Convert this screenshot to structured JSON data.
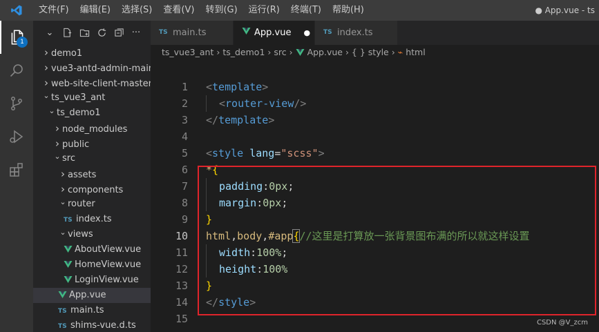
{
  "menu": [
    "文件(F)",
    "编辑(E)",
    "选择(S)",
    "查看(V)",
    "转到(G)",
    "运行(R)",
    "终端(T)",
    "帮助(H)"
  ],
  "window_title": "● App.vue - ts",
  "activity": {
    "badge": "1"
  },
  "explorer": {
    "items": [
      {
        "label": "demo1",
        "kind": "folder",
        "open": false,
        "depth": 0
      },
      {
        "label": "vue3-antd-admin-main",
        "kind": "folder",
        "open": false,
        "depth": 0
      },
      {
        "label": "web-site-client-master",
        "kind": "folder",
        "open": false,
        "depth": 0
      },
      {
        "label": "ts_vue3_ant",
        "kind": "folder",
        "open": true,
        "depth": 0
      },
      {
        "label": "ts_demo1",
        "kind": "folder",
        "open": true,
        "depth": 1
      },
      {
        "label": "node_modules",
        "kind": "folder",
        "open": false,
        "depth": 2
      },
      {
        "label": "public",
        "kind": "folder",
        "open": false,
        "depth": 2
      },
      {
        "label": "src",
        "kind": "folder",
        "open": true,
        "depth": 2
      },
      {
        "label": "assets",
        "kind": "folder",
        "open": false,
        "depth": 3
      },
      {
        "label": "components",
        "kind": "folder",
        "open": false,
        "depth": 3
      },
      {
        "label": "router",
        "kind": "folder",
        "open": true,
        "depth": 3
      },
      {
        "label": "index.ts",
        "kind": "ts",
        "depth": 4
      },
      {
        "label": "views",
        "kind": "folder",
        "open": true,
        "depth": 3
      },
      {
        "label": "AboutView.vue",
        "kind": "vue",
        "depth": 4
      },
      {
        "label": "HomeView.vue",
        "kind": "vue",
        "depth": 4
      },
      {
        "label": "LoginView.vue",
        "kind": "vue",
        "depth": 4
      },
      {
        "label": "App.vue",
        "kind": "vue",
        "depth": 3,
        "selected": true
      },
      {
        "label": "main.ts",
        "kind": "ts",
        "depth": 3
      },
      {
        "label": "shims-vue.d.ts",
        "kind": "ts",
        "depth": 3
      }
    ]
  },
  "tabs": [
    {
      "label": "main.ts",
      "kind": "ts",
      "active": false
    },
    {
      "label": "App.vue",
      "kind": "vue",
      "active": true,
      "dirty": true
    },
    {
      "label": "index.ts",
      "kind": "ts",
      "active": false
    }
  ],
  "breadcrumb": [
    "ts_vue3_ant",
    "ts_demo1",
    "src",
    "App.vue",
    "{ } style",
    "html"
  ],
  "code": {
    "current_line": 10,
    "lines": [
      {
        "n": "1",
        "indent": 0,
        "tokens": [
          [
            "c-punct",
            "<"
          ],
          [
            "c-tag",
            "template"
          ],
          [
            "c-punct",
            ">"
          ]
        ]
      },
      {
        "n": "2",
        "indent": 1,
        "tokens": [
          [
            "c-punct",
            "<"
          ],
          [
            "c-tag",
            "router-view"
          ],
          [
            "c-punct",
            "/>"
          ]
        ]
      },
      {
        "n": "3",
        "indent": 0,
        "tokens": [
          [
            "c-punct",
            "</"
          ],
          [
            "c-tag",
            "template"
          ],
          [
            "c-punct",
            ">"
          ]
        ]
      },
      {
        "n": "4",
        "indent": 0,
        "tokens": []
      },
      {
        "n": "5",
        "indent": 0,
        "tokens": [
          [
            "c-punct",
            "<"
          ],
          [
            "c-tag",
            "style"
          ],
          [
            "c-plain",
            " "
          ],
          [
            "c-attr",
            "lang"
          ],
          [
            "c-plain",
            "="
          ],
          [
            "c-str",
            "\"scss\""
          ],
          [
            "c-punct",
            ">"
          ]
        ]
      },
      {
        "n": "6",
        "indent": 0,
        "tokens": [
          [
            "c-sel",
            "*"
          ],
          [
            "c-brace",
            "{"
          ]
        ]
      },
      {
        "n": "7",
        "indent": 1,
        "tokens": [
          [
            "c-prop",
            "padding"
          ],
          [
            "c-plain",
            ":"
          ],
          [
            "c-num",
            "0px"
          ],
          [
            "c-plain",
            ";"
          ]
        ]
      },
      {
        "n": "8",
        "indent": 1,
        "tokens": [
          [
            "c-prop",
            "margin"
          ],
          [
            "c-plain",
            ":"
          ],
          [
            "c-num",
            "0px"
          ],
          [
            "c-plain",
            ";"
          ]
        ]
      },
      {
        "n": "9",
        "indent": 0,
        "tokens": [
          [
            "c-brace",
            "}"
          ]
        ]
      },
      {
        "n": "10",
        "indent": 0,
        "tokens": [
          [
            "c-sel",
            "html"
          ],
          [
            "c-plain",
            ","
          ],
          [
            "c-sel",
            "body"
          ],
          [
            "c-plain",
            ","
          ],
          [
            "c-sel",
            "#app"
          ],
          [
            "c-brace",
            "{"
          ],
          [
            "c-cmt",
            "//这里是打算放一张背景图布满的所以就这样设置"
          ]
        ]
      },
      {
        "n": "11",
        "indent": 1,
        "tokens": [
          [
            "c-prop",
            "width"
          ],
          [
            "c-plain",
            ":"
          ],
          [
            "c-num",
            "100%"
          ],
          [
            "c-plain",
            ";"
          ]
        ]
      },
      {
        "n": "12",
        "indent": 1,
        "tokens": [
          [
            "c-prop",
            "height"
          ],
          [
            "c-plain",
            ":"
          ],
          [
            "c-num",
            "100%"
          ]
        ]
      },
      {
        "n": "13",
        "indent": 0,
        "tokens": [
          [
            "c-brace",
            "}"
          ]
        ]
      },
      {
        "n": "14",
        "indent": 0,
        "tokens": [
          [
            "c-punct",
            "</"
          ],
          [
            "c-tag",
            "style"
          ],
          [
            "c-punct",
            ">"
          ]
        ]
      },
      {
        "n": "15",
        "indent": 0,
        "tokens": []
      }
    ]
  },
  "watermark": "CSDN @V_zcm",
  "colors": {
    "accent": "#0e70c0",
    "highlight_box": "#e0242b",
    "vue_green": "#41b883",
    "ts_blue": "#519aba"
  },
  "icons": [
    "vscode-logo-icon",
    "files-icon",
    "search-icon",
    "source-control-icon",
    "run-debug-icon",
    "extensions-icon",
    "new-file-icon",
    "new-folder-icon",
    "refresh-icon",
    "collapse-all-icon",
    "more-icon"
  ]
}
